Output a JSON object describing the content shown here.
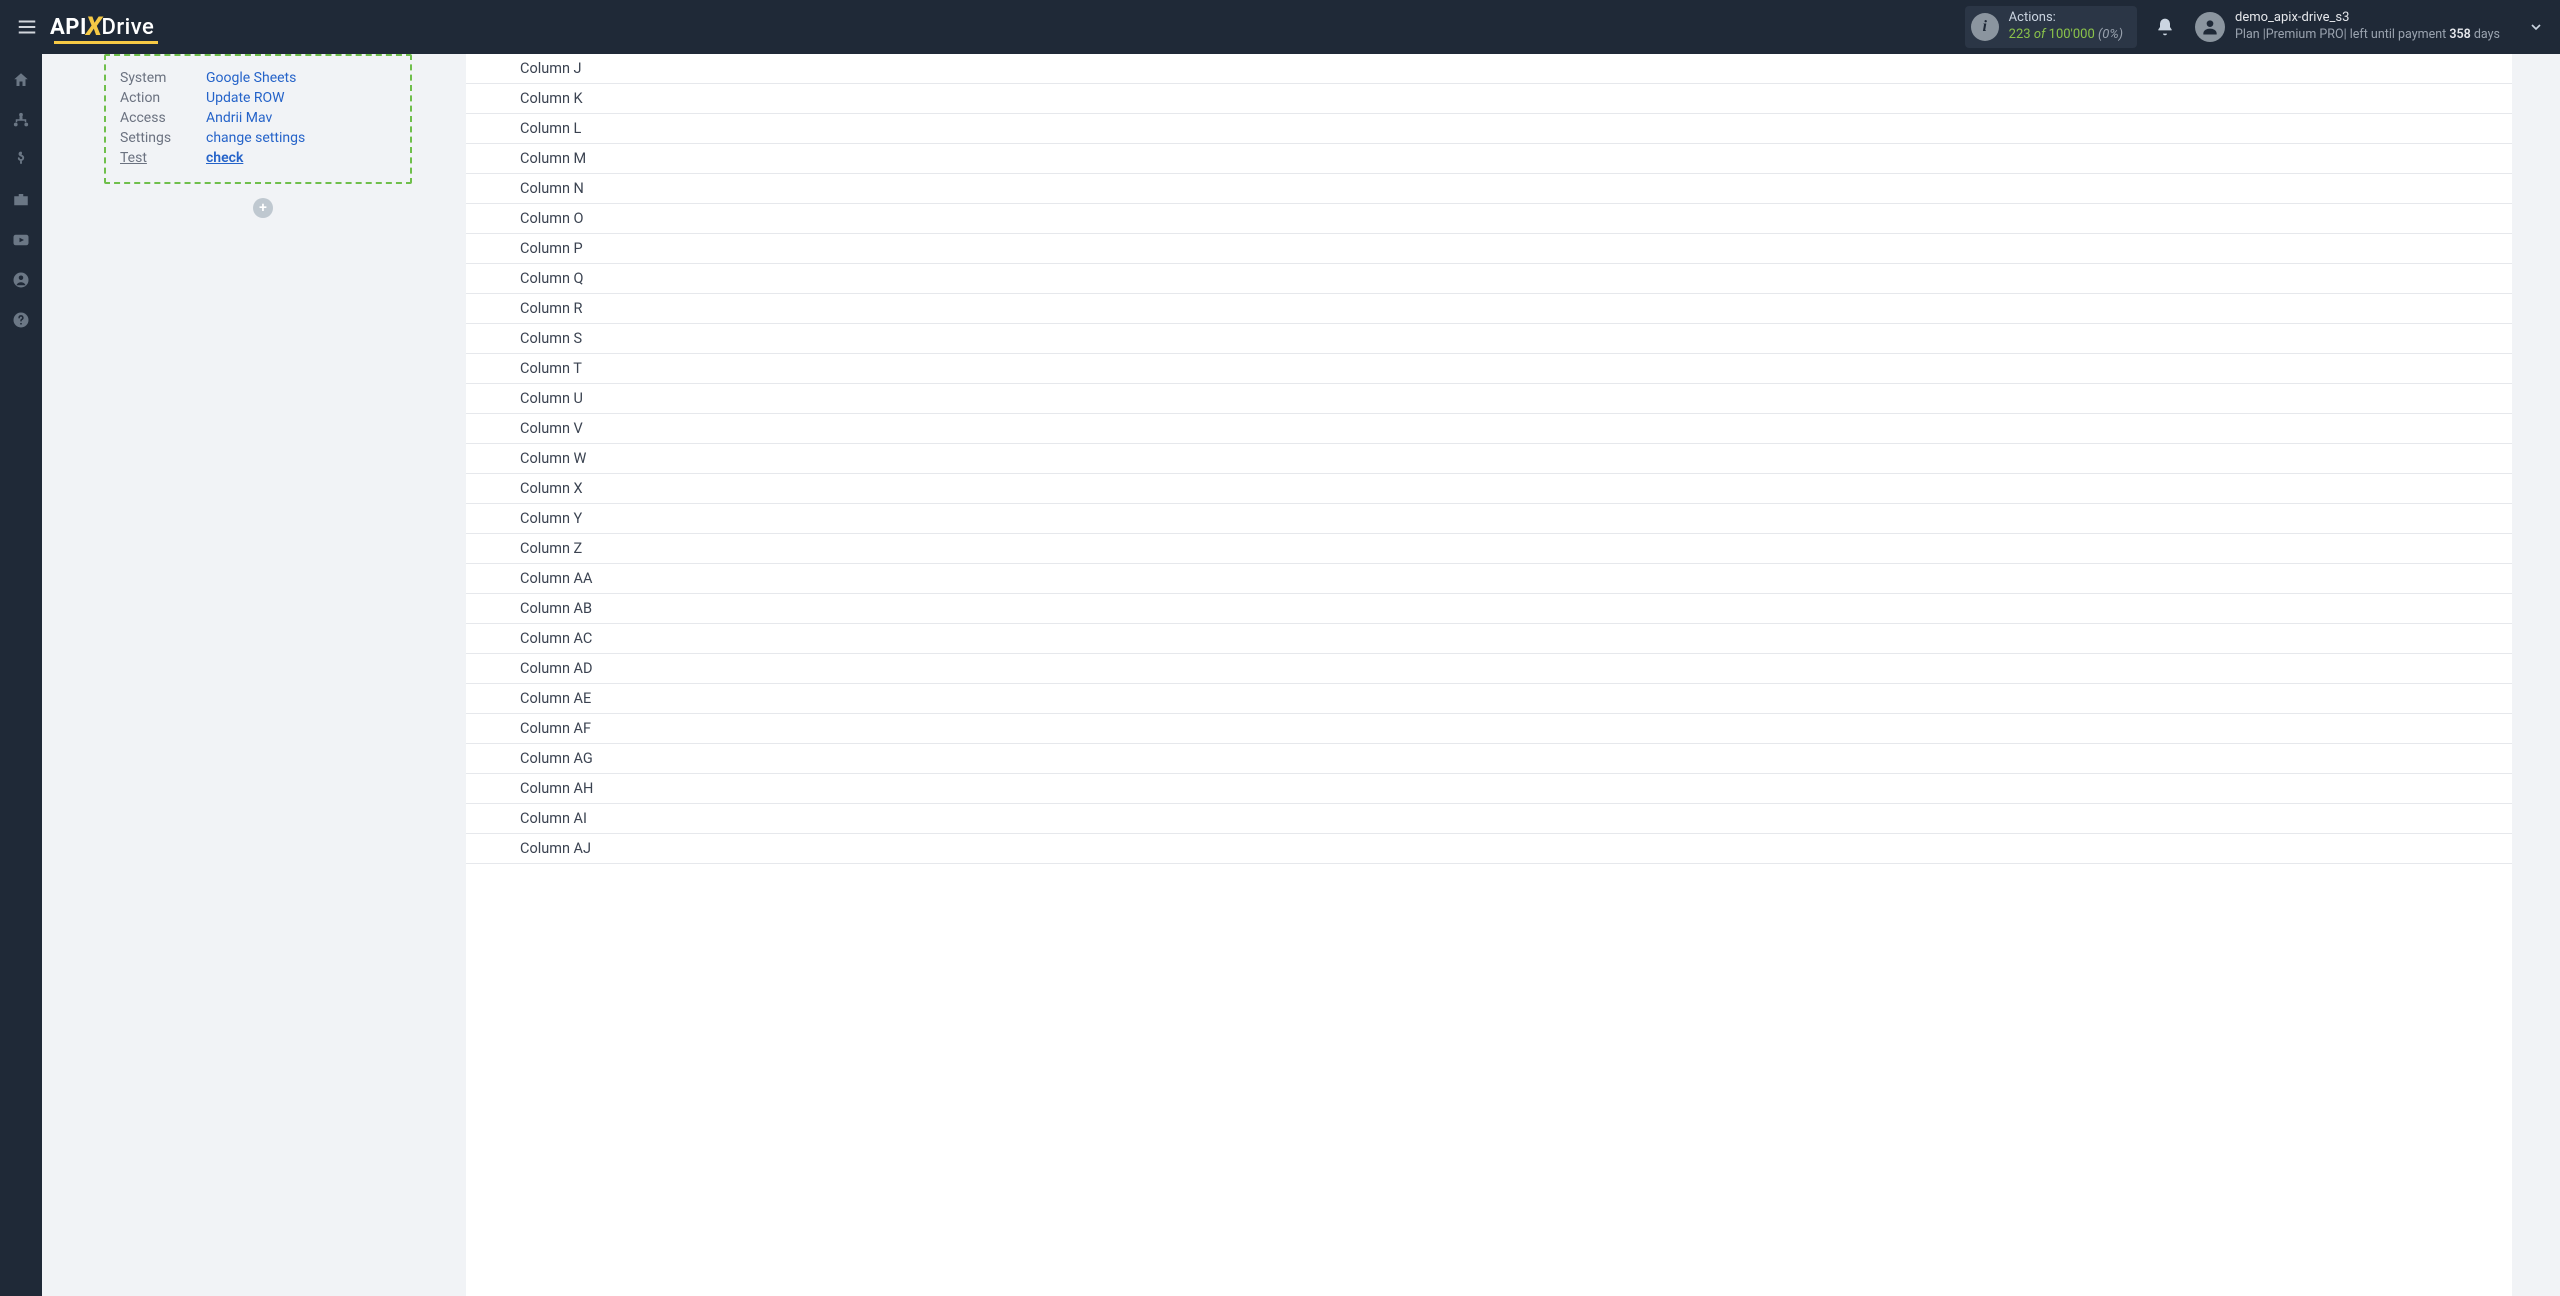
{
  "header": {
    "logo": {
      "part1": "API",
      "part2": "X",
      "part3": "Drive"
    },
    "actions": {
      "label": "Actions:",
      "count": "223",
      "of": "of",
      "limit": "100'000",
      "percent": "(0%)"
    },
    "user": {
      "name": "demo_apix-drive_s3",
      "plan_prefix": "Plan |",
      "plan_name": "Premium PRO",
      "plan_mid": "| left until payment ",
      "days": "358",
      "days_suffix": " days"
    }
  },
  "card": {
    "rows": [
      {
        "label": "System",
        "value": "Google Sheets"
      },
      {
        "label": "Action",
        "value": "Update ROW"
      },
      {
        "label": "Access",
        "value": "Andrii Mav"
      },
      {
        "label": "Settings",
        "value": "change settings"
      },
      {
        "label": "Test",
        "value": "check"
      }
    ]
  },
  "columns": [
    "Column J",
    "Column K",
    "Column L",
    "Column M",
    "Column N",
    "Column O",
    "Column P",
    "Column Q",
    "Column R",
    "Column S",
    "Column T",
    "Column U",
    "Column V",
    "Column W",
    "Column X",
    "Column Y",
    "Column Z",
    "Column AA",
    "Column AB",
    "Column AC",
    "Column AD",
    "Column AE",
    "Column AF",
    "Column AG",
    "Column AH",
    "Column AI",
    "Column AJ"
  ]
}
